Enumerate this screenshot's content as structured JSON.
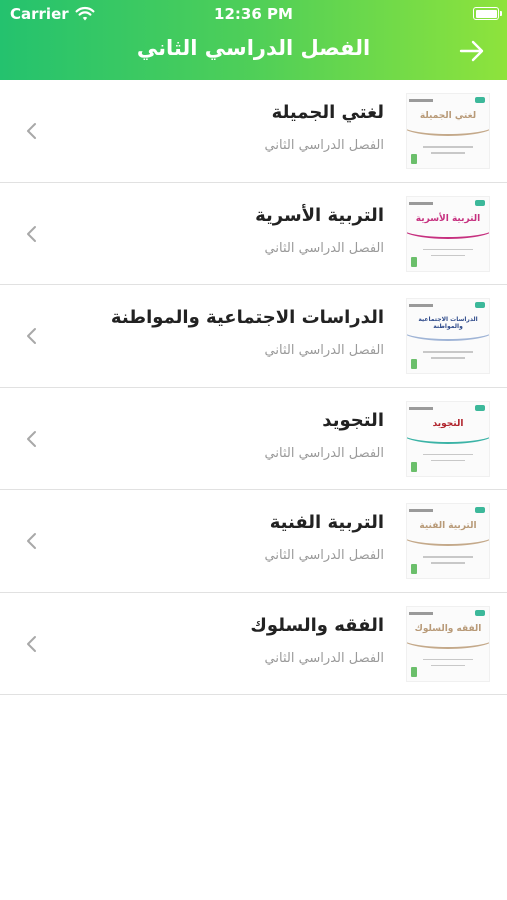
{
  "status_bar": {
    "carrier": "Carrier",
    "time": "12:36 PM"
  },
  "header": {
    "title": "الفصل الدراسي الثاني"
  },
  "books": [
    {
      "title": "لغتي الجميلة",
      "subtitle": "الفصل الدراسي الثاني",
      "cover_title": "لغتي الجميلة",
      "accent": "#c4a98a",
      "title_color": "#b89a78"
    },
    {
      "title": "التربية الأسرية",
      "subtitle": "الفصل الدراسي الثاني",
      "cover_title": "التربية الأسرية",
      "accent": "#c6307f",
      "title_color": "#c6307f"
    },
    {
      "title": "الدراسات الاجتماعية والمواطنة",
      "subtitle": "الفصل الدراسي الثاني",
      "cover_title": "الدراسات الاجتماعية والمواطنة",
      "accent": "#9fb4d6",
      "title_color": "#2e4a8a"
    },
    {
      "title": "التجويد",
      "subtitle": "الفصل الدراسي الثاني",
      "cover_title": "التجويد",
      "accent": "#3bb3a6",
      "title_color": "#b0232c"
    },
    {
      "title": "التربية الفنية",
      "subtitle": "الفصل الدراسي الثاني",
      "cover_title": "التربية الفنية",
      "accent": "#c4a98a",
      "title_color": "#b89a78"
    },
    {
      "title": "الفقه والسلوك",
      "subtitle": "الفصل الدراسي الثاني",
      "cover_title": "الفقه والسلوك",
      "accent": "#c4a98a",
      "title_color": "#b89a78"
    }
  ],
  "icons": {
    "wifi": "wifi-icon",
    "battery": "battery-icon",
    "forward": "arrow-right-icon",
    "row_chevron": "chevron-left-icon"
  },
  "colors": {
    "header_start": "#24c26e",
    "header_end": "#8ee33c",
    "title_text": "#222222",
    "subtitle_text": "#9a9a9a",
    "separator": "#e1e1e1"
  }
}
